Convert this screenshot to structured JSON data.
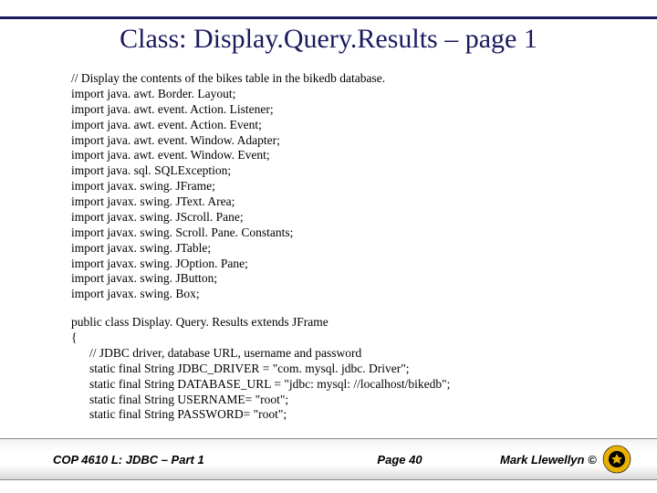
{
  "title": "Class:  Display.Query.Results – page 1",
  "code": {
    "block1": [
      "// Display the contents of the bikes table in the bikedb database.",
      "import java. awt. Border. Layout;",
      "import java. awt. event. Action. Listener;",
      "import java. awt. event. Action. Event;",
      "import java. awt. event. Window. Adapter;",
      "import java. awt. event. Window. Event;",
      "import java. sql. SQLException;",
      "import javax. swing. JFrame;",
      "import javax. swing. JText. Area;",
      "import javax. swing. JScroll. Pane;",
      "import javax. swing. Scroll. Pane. Constants;",
      "import javax. swing. JTable;",
      "import javax. swing. JOption. Pane;",
      "import javax. swing. JButton;",
      "import javax. swing. Box;"
    ],
    "block2": [
      "public class Display. Query. Results extends JFrame",
      "{"
    ],
    "block3": [
      "// JDBC driver, database URL, username and password",
      "static final String JDBC_DRIVER = \"com. mysql. jdbc. Driver\";",
      "static final String DATABASE_URL = \"jdbc: mysql: //localhost/bikedb\";",
      "static final String USERNAME= \"root\";",
      "static final String PASSWORD= \"root\";"
    ]
  },
  "footer": {
    "left": "COP 4610 L: JDBC – Part 1",
    "center": "Page 40",
    "right": "Mark Llewellyn ©"
  }
}
